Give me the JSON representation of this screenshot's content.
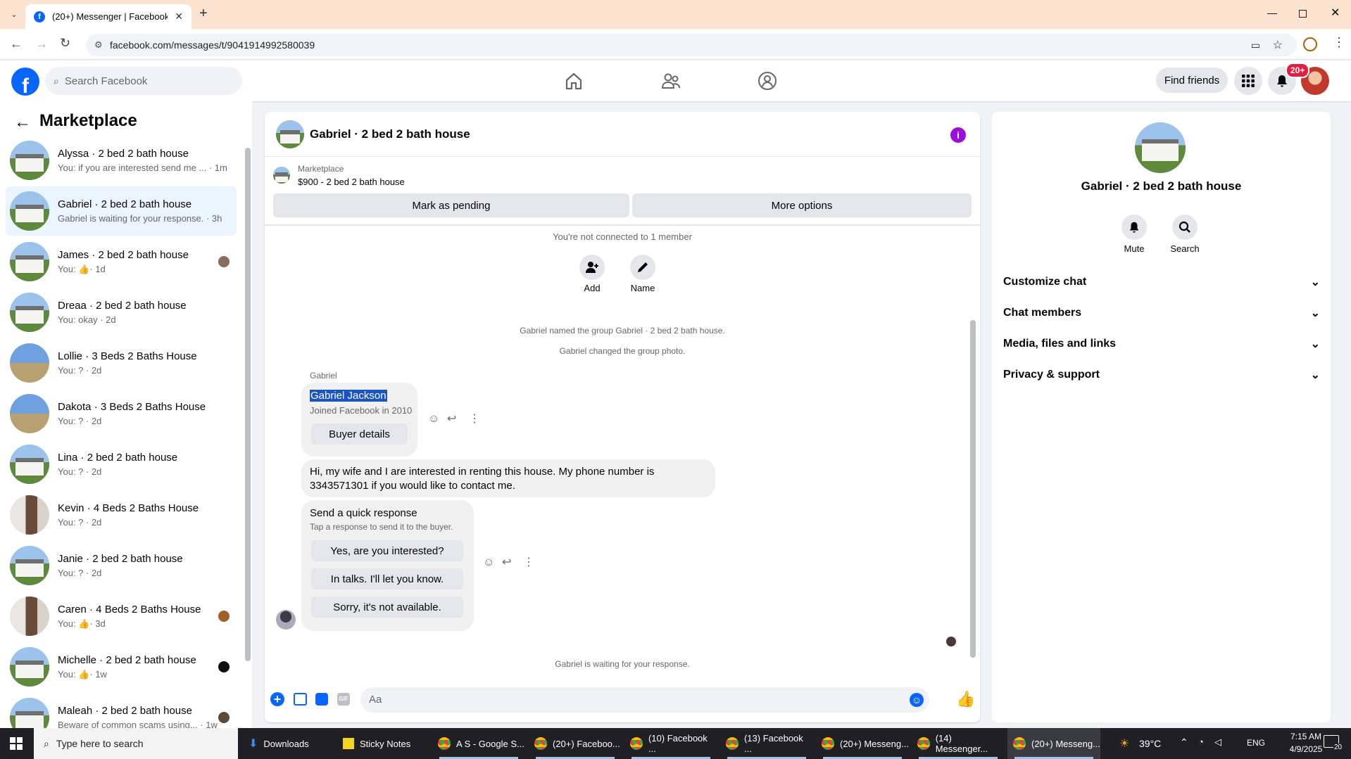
{
  "browser": {
    "tab_title": "(20+) Messenger | Facebook",
    "url": "facebook.com/messages/t/9041914992580039"
  },
  "fb_header": {
    "search_placeholder": "Search Facebook",
    "find_friends": "Find friends",
    "notif_badge": "20+",
    "accent": "#0866ff"
  },
  "sidebar": {
    "title": "Marketplace",
    "items": [
      {
        "title": "Alyssa · 2 bed 2 bath house",
        "preview": "You: if you are interested send me ... · 1m"
      },
      {
        "title": "Gabriel · 2 bed 2 bath house",
        "preview": "Gabriel is waiting for your response. · 3h"
      },
      {
        "title": "James · 2 bed 2 bath house",
        "preview_prefix": "You:",
        "preview_suffix": "· 1d"
      },
      {
        "title": "Dreaa · 2 bed 2 bath house",
        "preview": "You: okay · 2d"
      },
      {
        "title": "Lollie · 3 Beds 2 Baths House",
        "preview": "You: ? · 2d"
      },
      {
        "title": "Dakota · 3 Beds 2 Baths House",
        "preview": "You: ? · 2d"
      },
      {
        "title": "Lina · 2 bed 2 bath house",
        "preview": "You: ? · 2d"
      },
      {
        "title": "Kevin · 4 Beds 2 Baths House",
        "preview": "You: ? · 2d"
      },
      {
        "title": "Janie · 2 bed 2 bath house",
        "preview": "You: ? · 2d"
      },
      {
        "title": "Caren · 4 Beds 2 Baths House",
        "preview_prefix": "You:",
        "preview_suffix": "· 3d"
      },
      {
        "title": "Michelle · 2 bed 2 bath house",
        "preview_prefix": "You:",
        "preview_suffix": "· 1w"
      },
      {
        "title": "Maleah · 2 bed 2 bath house",
        "preview": "Beware of common scams using... · 1w"
      }
    ]
  },
  "chat": {
    "header_title": "Gabriel · 2 bed 2 bath house",
    "listing_label": "Marketplace",
    "listing_detail": "$900 - 2 bed 2 bath house",
    "mark_pending": "Mark as pending",
    "more_options": "More options",
    "not_connected": "You're not connected to 1 member",
    "add_label": "Add",
    "name_label": "Name",
    "sys1": "Gabriel named the group Gabriel · 2 bed 2 bath house.",
    "sys2": "Gabriel changed the group photo.",
    "sender": "Gabriel",
    "profile_name": "Gabriel Jackson",
    "profile_joined": "Joined Facebook in 2010",
    "buyer_details": "Buyer details",
    "message": "Hi, my wife and I are interested in renting this house. My phone number is 3343571301 if you would like to contact me.",
    "quick_title": "Send a quick response",
    "quick_sub": "Tap a response to send it to the buyer.",
    "quick1": "Yes, are you interested?",
    "quick2": "In talks. I'll let you know.",
    "quick3": "Sorry, it's not available.",
    "waiting": "Gabriel is waiting for your response.",
    "composer_placeholder": "Aa"
  },
  "details": {
    "title": "Gabriel · 2 bed 2 bath house",
    "mute": "Mute",
    "search": "Search",
    "sections": [
      "Customize chat",
      "Chat members",
      "Media, files and links",
      "Privacy & support"
    ]
  },
  "taskbar": {
    "search_placeholder": "Type here to search",
    "apps": [
      "Downloads",
      "Sticky Notes",
      "A S - Google S...",
      "(20+) Faceboo...",
      "(10) Facebook ...",
      "(13) Facebook ...",
      "(20+) Messeng...",
      "(14) Messenger...",
      "(20+) Messeng..."
    ],
    "temp": "39°C",
    "lang": "ENG",
    "time": "7:15 AM",
    "date": "4/9/2025",
    "notif_count": "20"
  }
}
